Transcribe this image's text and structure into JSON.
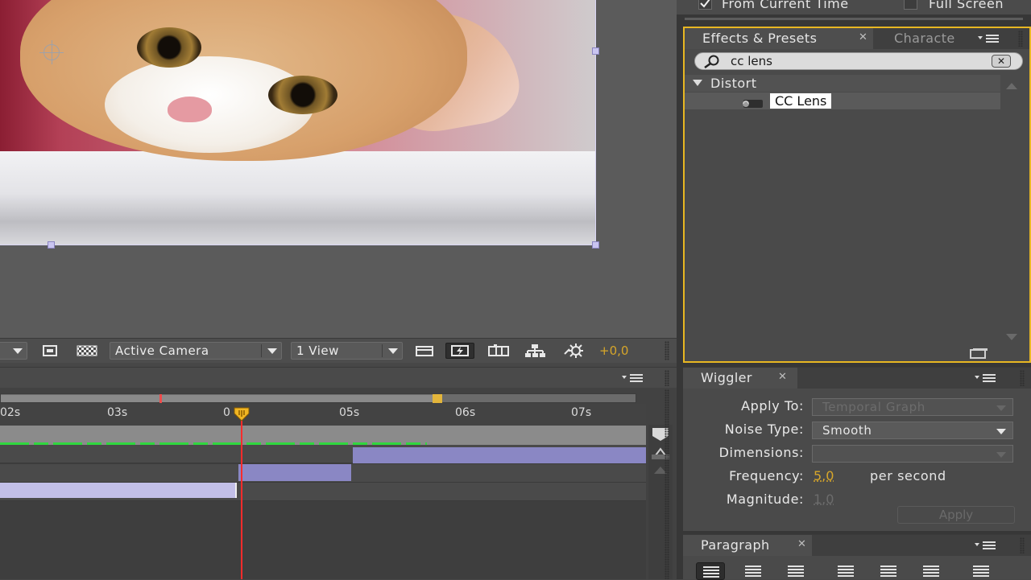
{
  "viewer": {
    "camera_label": "Active Camera",
    "view_layout_label": "1 View",
    "exposure_value": "+0,0"
  },
  "top_options": {
    "from_current_time": "From Current Time",
    "full_screen": "Full Screen"
  },
  "timeline": {
    "ruler_ticks": [
      "02s",
      "03s",
      "0",
      "05s",
      "06s",
      "07s"
    ]
  },
  "effects_presets": {
    "tab_label": "Effects & Presets",
    "other_tab_label": "Characte",
    "search_value": "cc lens",
    "category": "Distort",
    "effect": "CC Lens"
  },
  "wiggler": {
    "tab_label": "Wiggler",
    "apply_to_label": "Apply To:",
    "apply_to_value": "Temporal Graph",
    "noise_type_label": "Noise Type:",
    "noise_type_value": "Smooth",
    "dimensions_label": "Dimensions:",
    "frequency_label": "Frequency:",
    "frequency_value": "5,0",
    "frequency_unit": "per second",
    "magnitude_label": "Magnitude:",
    "magnitude_value": "1,0",
    "apply_label": "Apply"
  },
  "paragraph": {
    "tab_label": "Paragraph"
  },
  "colors": {
    "panel_focus": "#e8b722",
    "playhead": "#ff2c2c",
    "layer_bar": "#8a87c4",
    "value_orange": "#d7a62a"
  }
}
